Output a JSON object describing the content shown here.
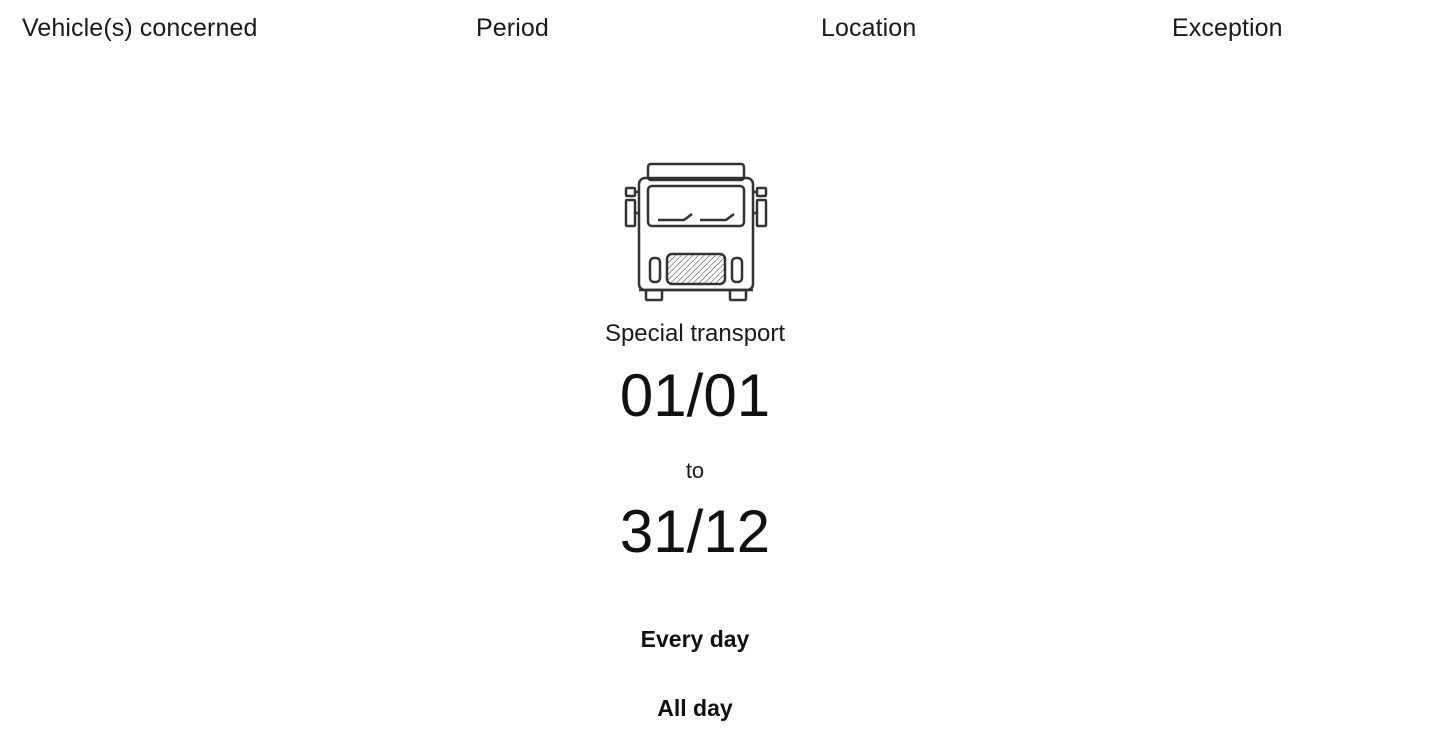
{
  "columns": {
    "vehicles": "Vehicle(s) concerned",
    "period": "Period",
    "location": "Location",
    "exception": "Exception"
  },
  "vehicle": {
    "icon": "truck-front-icon",
    "label": "Special transport"
  },
  "period": {
    "from": "01/01",
    "to_label": "to",
    "to": "31/12",
    "days": "Every day",
    "hours": "All day"
  },
  "colors": {
    "text": "#1a1a1a",
    "background": "#ffffff",
    "icon_stroke": "#333333"
  }
}
